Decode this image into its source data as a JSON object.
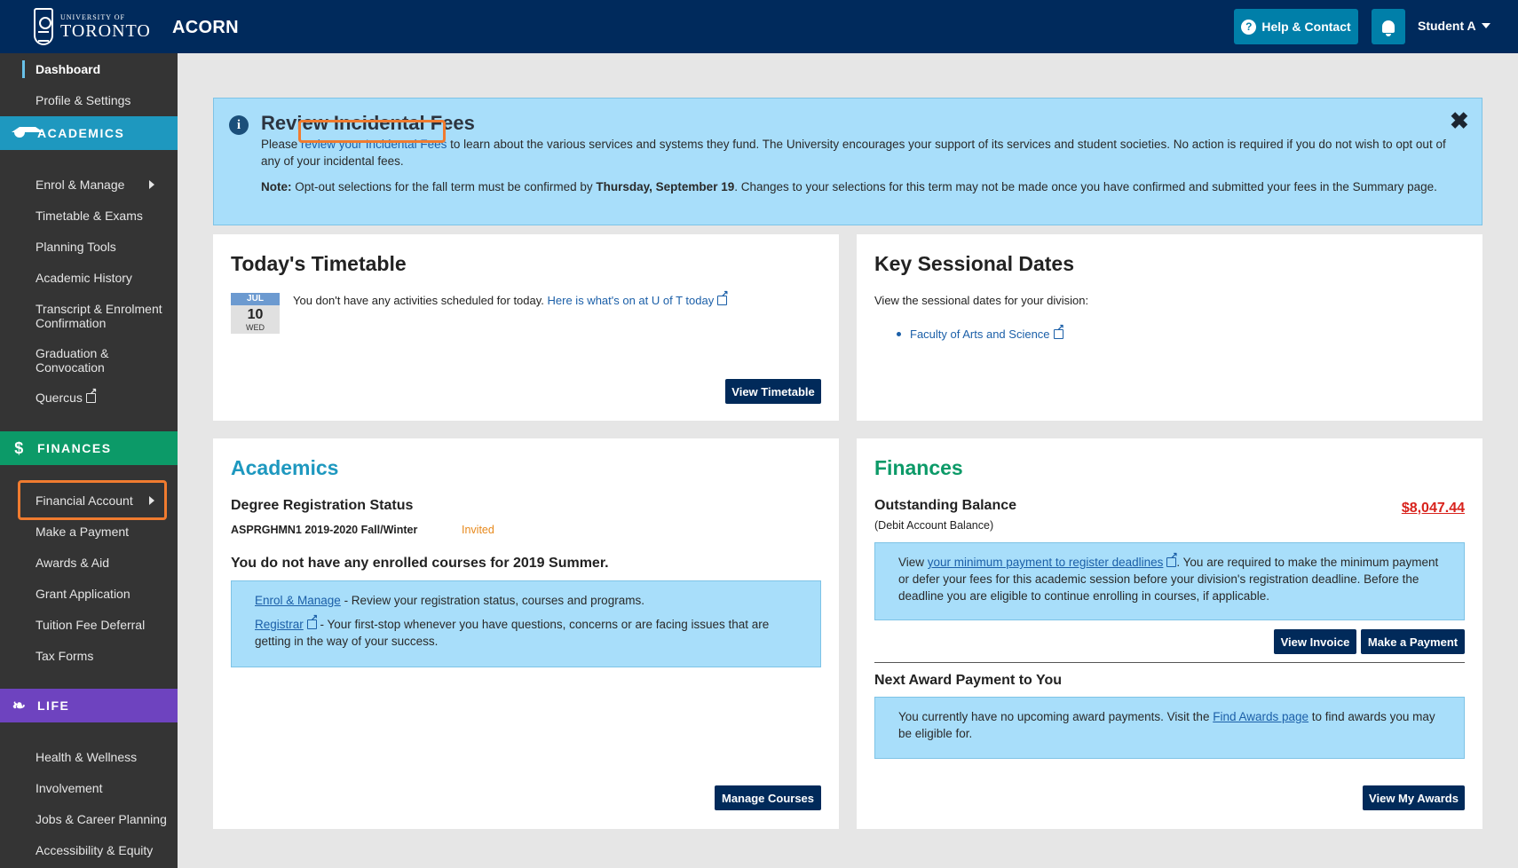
{
  "header": {
    "logo_small": "UNIVERSITY OF",
    "logo_large": "TORONTO",
    "app_name": "ACORN",
    "help_label": "Help & Contact",
    "user_label": "Student A"
  },
  "sidebar": {
    "top_items": [
      {
        "label": "Dashboard"
      },
      {
        "label": "Profile & Settings"
      }
    ],
    "academics": {
      "heading": "ACADEMICS",
      "items": [
        "Enrol & Manage",
        "Timetable & Exams",
        "Planning Tools",
        "Academic History",
        "Transcript & Enrolment Confirmation",
        "Graduation & Convocation",
        "Quercus"
      ]
    },
    "finances": {
      "heading": "FINANCES",
      "items": [
        "Financial Account",
        "Make a Payment",
        "Awards & Aid",
        "Grant Application",
        "Tuition Fee Deferral",
        "Tax Forms"
      ]
    },
    "life": {
      "heading": "LIFE",
      "items": [
        "Health & Wellness",
        "Involvement",
        "Jobs & Career Planning",
        "Accessibility & Equity"
      ]
    }
  },
  "alert": {
    "title": "Review Incidental Fees",
    "text_before": "Please ",
    "link_text": "review your Incidental Fees",
    "text_after": " to learn about the various services and systems they fund. The University encourages your support of its services and student societies. No action is required if you do not wish to opt out of any of your incidental fees.",
    "note_label": "Note:",
    "note_before": " Opt-out selections for the fall term must be confirmed by ",
    "note_date": "Thursday, September 19",
    "note_after": ". Changes to your selections for this term may not be made once you have confirmed and submitted your fees in the Summary page.",
    "close_symbol": "✖"
  },
  "timetable": {
    "title": "Today's Timetable",
    "month": "JUL",
    "day": "10",
    "weekday": "WED",
    "message": "You don't have any activities scheduled for today. ",
    "link_text": "Here is what's on at U of T today",
    "button": "View Timetable"
  },
  "sessional": {
    "title": "Key Sessional Dates",
    "intro": "View the sessional dates for your division:",
    "link_text": "Faculty of Arts and Science"
  },
  "academics_card": {
    "title": "Academics",
    "degree_heading": "Degree Registration Status",
    "program": "ASPRGHMN1 2019-2020 Fall/Winter",
    "status": "Invited",
    "enrolled_message": "You do not have any enrolled courses for 2019 Summer.",
    "enrol_link": "Enrol & Manage",
    "enrol_desc": " - Review your registration status, courses and programs.",
    "registrar_link": "Registrar",
    "registrar_desc": " - Your first-stop whenever you have questions, concerns or are facing issues that are getting in the way of your success.",
    "button": "Manage Courses"
  },
  "finances_card": {
    "title": "Finances",
    "balance_heading": "Outstanding Balance",
    "balance_sub": "(Debit Account Balance)",
    "balance_amount": "$8,047.44",
    "info_before": "View ",
    "info_link": "your minimum payment to register deadlines",
    "info_after": ". You are required to make the minimum payment or defer your fees for this academic session before your division's registration deadline. Before the deadline you are eligible to continue enrolling in courses, if applicable.",
    "view_invoice": "View Invoice",
    "make_payment": "Make a Payment",
    "award_heading": "Next Award Payment to You",
    "award_before": "You currently have no upcoming award payments. Visit the ",
    "award_link": "Find Awards page",
    "award_after": " to find awards you may be eligible for.",
    "view_awards": "View My Awards"
  },
  "colors": {
    "topbar": "#002a5c",
    "sidebar": "#343434",
    "academics": "#1e98bf",
    "finances": "#0c9a68",
    "life": "#6e43bf",
    "alert_bg": "#a8defa",
    "balance": "#d8221c",
    "highlight": "#f07b2f"
  },
  "icons": [
    "university-crest-icon",
    "help-icon",
    "bell-icon",
    "caret-down-icon",
    "graduation-cap-icon",
    "dollar-icon",
    "leaf-icon",
    "info-icon",
    "close-icon",
    "external-link-icon",
    "arrow-right-icon"
  ]
}
